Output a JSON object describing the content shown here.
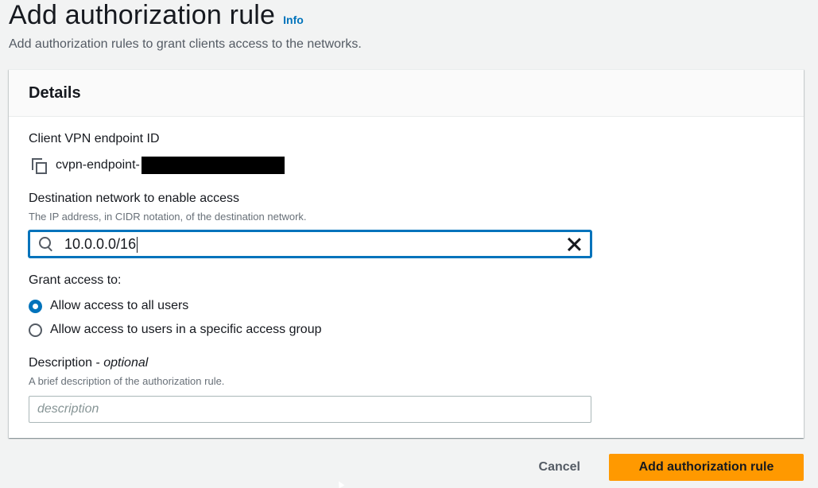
{
  "header": {
    "title": "Add authorization rule",
    "info_link": "Info",
    "subtitle": "Add authorization rules to grant clients access to the networks."
  },
  "details": {
    "title": "Details",
    "endpoint": {
      "label": "Client VPN endpoint ID",
      "value": "cvpn-endpoint-",
      "icon": "copy-icon"
    },
    "destination": {
      "label": "Destination network to enable access",
      "description": "The IP address, in CIDR notation, of the destination network.",
      "value": "10.0.0.0/16",
      "search_icon": "search-icon",
      "clear_icon": "close-icon"
    },
    "grant_access": {
      "label": "Grant access to:",
      "options": [
        {
          "label": "Allow access to all users",
          "selected": true
        },
        {
          "label": "Allow access to users in a specific access group",
          "selected": false
        }
      ]
    },
    "description_field": {
      "label": "Description - ",
      "optional_label": "optional",
      "description": "A brief description of the authorization rule.",
      "placeholder": "description",
      "value": ""
    }
  },
  "actions": {
    "cancel_label": "Cancel",
    "submit_label": "Add authorization rule"
  },
  "colors": {
    "accent": "#0073bb",
    "primary_button": "#ff9900",
    "background": "#f2f3f3"
  }
}
